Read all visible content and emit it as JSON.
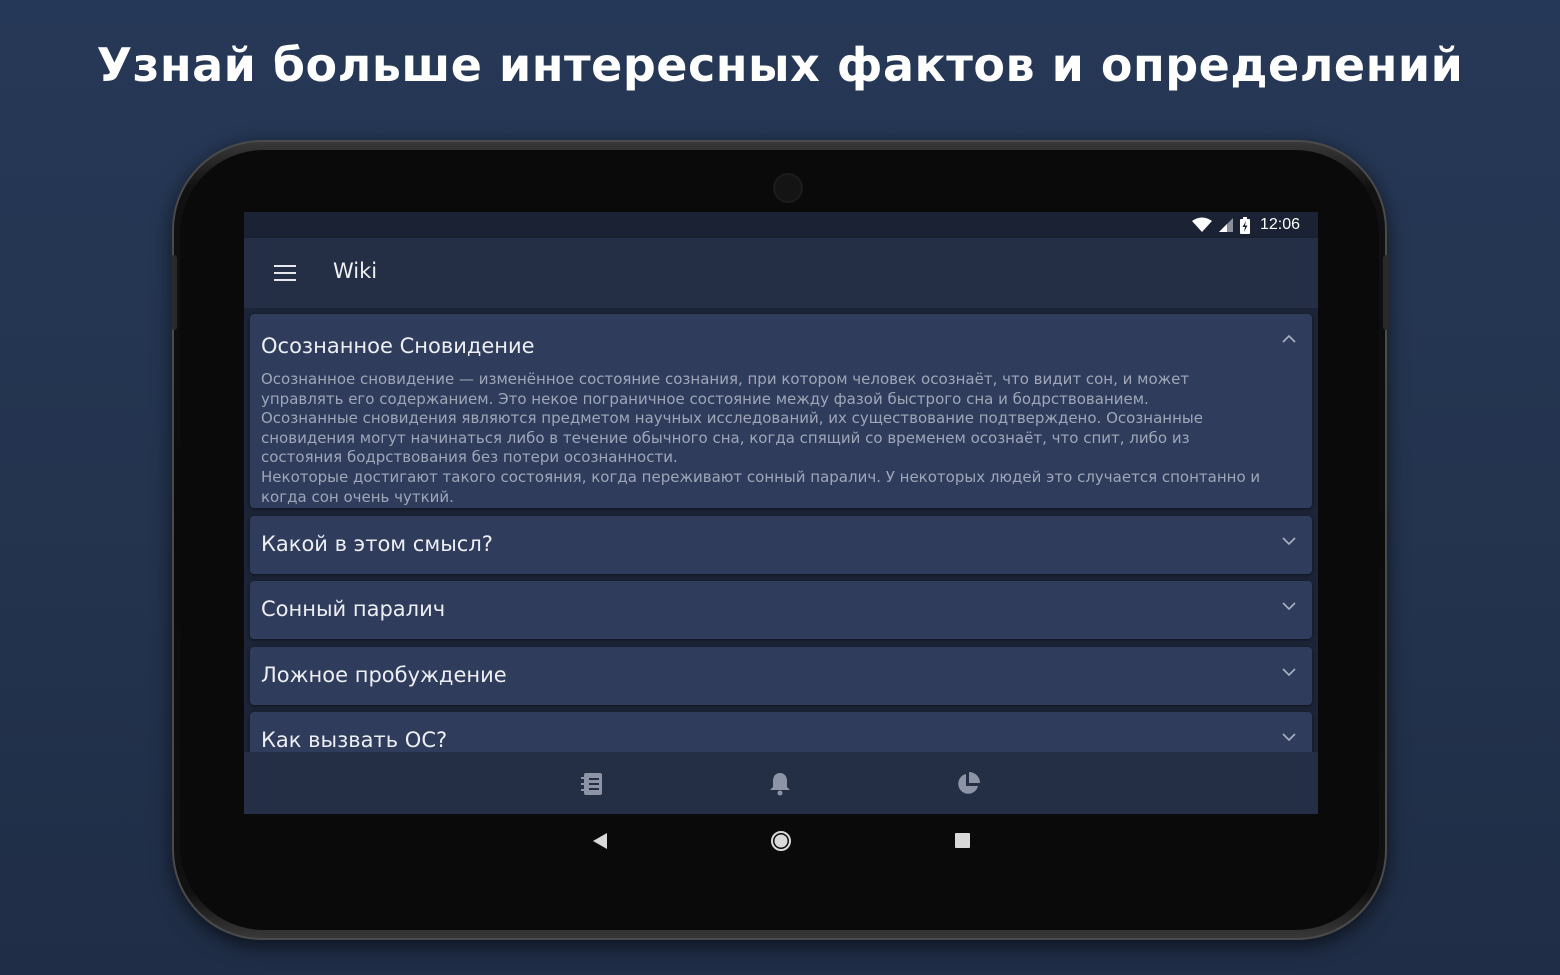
{
  "promo": {
    "title": "Узнай больше интересных фактов и определений"
  },
  "status_bar": {
    "time": "12:06",
    "icons": [
      "wifi-icon",
      "cell-signal-icon",
      "battery-charging-icon"
    ]
  },
  "appbar": {
    "title": "Wiki",
    "menu_icon": "hamburger-menu-icon"
  },
  "articles": [
    {
      "title": "Осознанное Сновидение",
      "expanded": true,
      "body": "Осознанное сновидение — изменённое состояние сознания, при котором человек осознаёт, что видит сон, и может\nуправлять его содержанием. Это некое пограничное состояние между фазой быстрого сна и бодрствованием.\nОсознанные сновидения являются предметом научных исследований, их существование подтверждено. Осознанные\nсновидения могут начинаться либо в течение обычного сна, когда спящий со временем осознаёт, что спит, либо из\nсостояния бодрствования без потери осознанности.\nНекоторые достигают такого состояния, когда переживают сонный паралич. У некоторых людей это случается спонтанно и\nкогда сон очень чуткий."
    },
    {
      "title": "Какой в этом смысл?",
      "expanded": false
    },
    {
      "title": "Сонный паралич",
      "expanded": false
    },
    {
      "title": "Ложное пробуждение",
      "expanded": false
    },
    {
      "title": "Как вызвать ОС?",
      "expanded": false
    }
  ],
  "bottom_nav": {
    "items": [
      {
        "icon": "journal-icon"
      },
      {
        "icon": "bell-icon"
      },
      {
        "icon": "pie-chart-icon"
      }
    ]
  },
  "system_nav": {
    "icons": [
      "back-icon",
      "home-icon",
      "recents-icon"
    ]
  },
  "colors": {
    "background": "#263857",
    "card": "#2f3c5c",
    "appbar": "#242e45",
    "text_primary": "#eceef3",
    "text_secondary": "#9ea6b8"
  }
}
